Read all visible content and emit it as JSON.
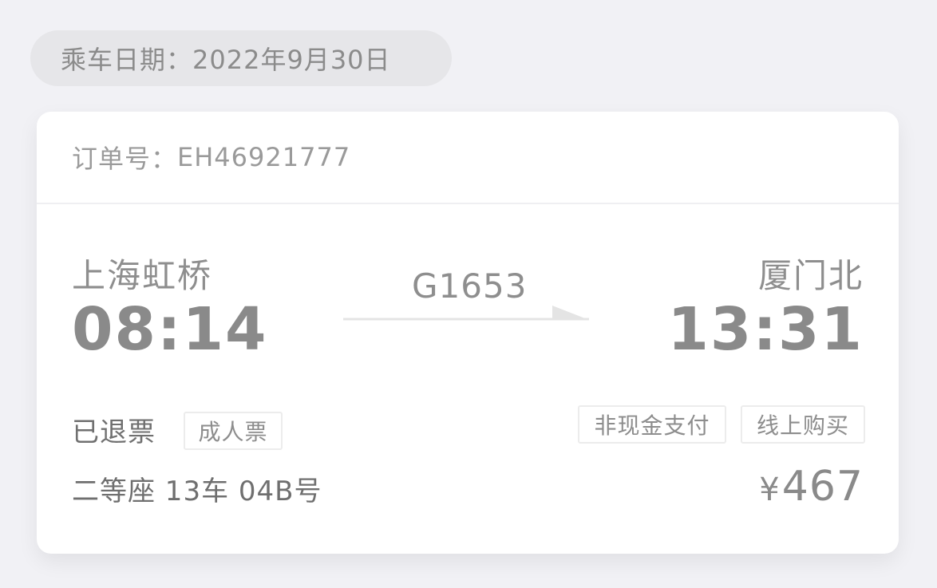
{
  "ride_date": {
    "label": "乘车日期：",
    "value": "2022年9月30日"
  },
  "order": {
    "label": "订单号：",
    "number": "EH46921777"
  },
  "trip": {
    "from_station": "上海虹桥",
    "from_time": "08:14",
    "to_station": "厦门北",
    "to_time": "13:31",
    "train_no": "G1653"
  },
  "ticket": {
    "status": "已退票",
    "type_tag": "成人票",
    "payment_tag": "非现金支付",
    "purchase_tag": "线上购买",
    "seat": "二等座 13车 04B号",
    "price_currency": "¥",
    "price_value": "467"
  },
  "colors": {
    "background": "#f1f1f5",
    "card": "#ffffff",
    "text_gray": "#8a8a8a",
    "arrow": "#e6e6e6"
  },
  "icons": {
    "direction": "right-arrow-icon"
  }
}
